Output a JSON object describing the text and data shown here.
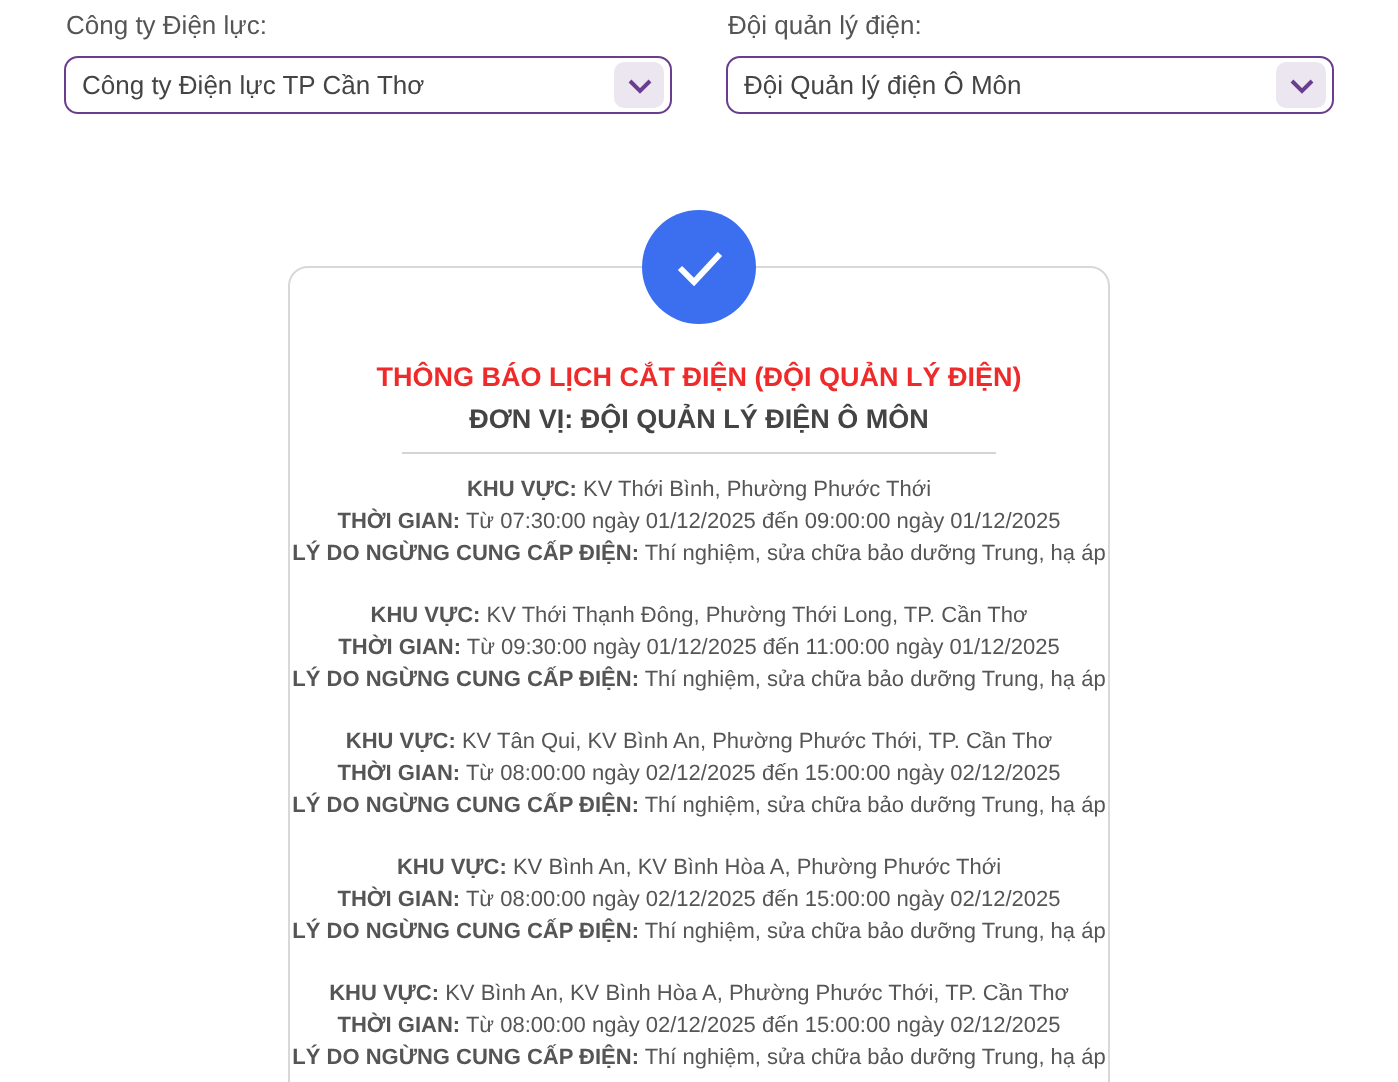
{
  "filters": [
    {
      "label": "Công ty Điện lực:",
      "value": "Công ty Điện lực TP Cần Thơ"
    },
    {
      "label": "Đội quản lý điện:",
      "value": "Đội Quản lý điện Ô Môn"
    }
  ],
  "notice": {
    "title": "THÔNG BÁO LỊCH CẮT ĐIỆN (ĐỘI QUẢN LÝ ĐIỆN)",
    "unit": "ĐƠN VỊ: ĐỘI QUẢN LÝ ĐIỆN Ô MÔN",
    "entries": [
      {
        "area": "**KHU VỰC:** KV Thới Bình, Phường Phước Thới",
        "time": "**THỜI GIAN:** Từ 07:30:00 ngày 01/12/2025 đến 09:00:00 ngày 01/12/2025",
        "reason": "**LÝ DO NGỪNG CUNG CẤP ĐIỆN:** Thí nghiệm, sửa chữa bảo dưỡng Trung, hạ áp"
      },
      {
        "area": "**KHU VỰC:** KV Thới Thạnh Đông, Phường Thới Long, TP. Cần Thơ",
        "time": "**THỜI GIAN:** Từ 09:30:00 ngày 01/12/2025 đến 11:00:00 ngày 01/12/2025",
        "reason": "**LÝ DO NGỪNG CUNG CẤP ĐIỆN:** Thí nghiệm, sửa chữa bảo dưỡng Trung, hạ áp"
      },
      {
        "area": "**KHU VỰC:** KV Tân Qui, KV Bình An, Phường Phước Thới, TP. Cần Thơ",
        "time": "**THỜI GIAN:** Từ 08:00:00 ngày 02/12/2025 đến 15:00:00 ngày 02/12/2025",
        "reason": "**LÝ DO NGỪNG CUNG CẤP ĐIỆN:** Thí nghiệm, sửa chữa bảo dưỡng Trung, hạ áp"
      },
      {
        "area": "**KHU VỰC:** KV Bình An, KV Bình Hòa A, Phường Phước Thới",
        "time": "**THỜI GIAN:** Từ 08:00:00 ngày 02/12/2025 đến 15:00:00 ngày 02/12/2025",
        "reason": "**LÝ DO NGỪNG CUNG CẤP ĐIỆN:** Thí nghiệm, sửa chữa bảo dưỡng Trung, hạ áp"
      },
      {
        "area": "**KHU VỰC:** KV Bình An, KV Bình Hòa A, Phường Phước Thới, TP. Cần Thơ",
        "time": "**THỜI GIAN:** Từ 08:00:00 ngày 02/12/2025 đến 15:00:00 ngày 02/12/2025",
        "reason": "**LÝ DO NGỪNG CUNG CẤP ĐIỆN:** Thí nghiệm, sửa chữa bảo dưỡng Trung, hạ áp"
      }
    ]
  }
}
